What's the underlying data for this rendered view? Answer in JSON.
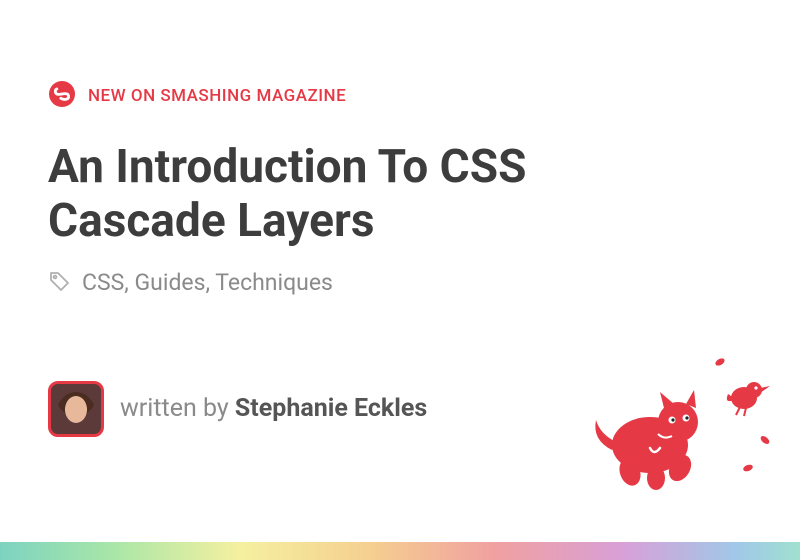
{
  "kicker": "NEW ON SMASHING MAGAZINE",
  "title": "An Introduction To CSS Cascade Layers",
  "tags": "CSS, Guides, Techniques",
  "byline_prefix": "written by ",
  "author": "Stephanie Eckles",
  "colors": {
    "brand_red": "#e63946",
    "heading": "#3d3d3d",
    "muted": "#8a8a8a"
  }
}
